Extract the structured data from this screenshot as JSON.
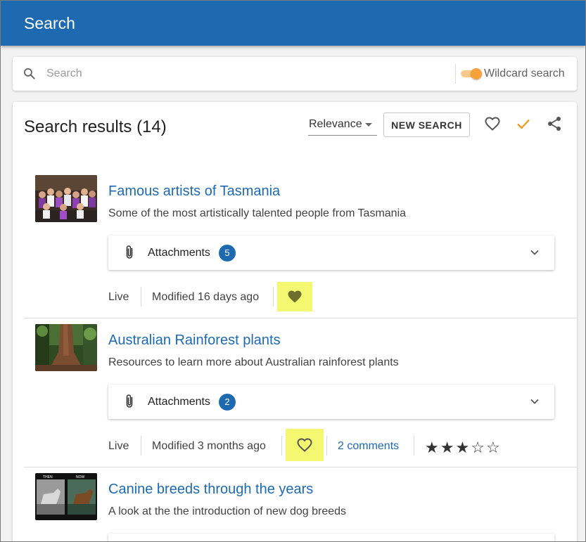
{
  "appbar": {
    "title": "Search"
  },
  "search": {
    "placeholder": "Search",
    "value": "",
    "wildcard_label": "Wildcard search"
  },
  "results": {
    "heading": "Search results (14)",
    "sort_value": "Relevance",
    "new_search_label": "NEW SEARCH",
    "accent_color": "#f29a1f",
    "brand_color": "#1e6ab1",
    "items": [
      {
        "title": "Famous artists of Tasmania",
        "description": "Some of the most artistically talented people from Tasmania",
        "attachments_label": "Attachments",
        "attachments_count": "5",
        "status": "Live",
        "modified": "Modified 16 days ago",
        "favourite": true
      },
      {
        "title": "Australian Rainforest plants",
        "description": "Resources to learn more about Australian rainforest plants",
        "attachments_label": "Attachments",
        "attachments_count": "2",
        "status": "Live",
        "modified": "Modified 3 months ago",
        "favourite": false,
        "comments": "2 comments",
        "rating": 3,
        "rating_max": 5
      },
      {
        "title": "Canine breeds through the years",
        "description": "A look at the the introduction of new dog breeds",
        "thumb_labels": [
          "THEN",
          "NOW"
        ]
      }
    ]
  }
}
